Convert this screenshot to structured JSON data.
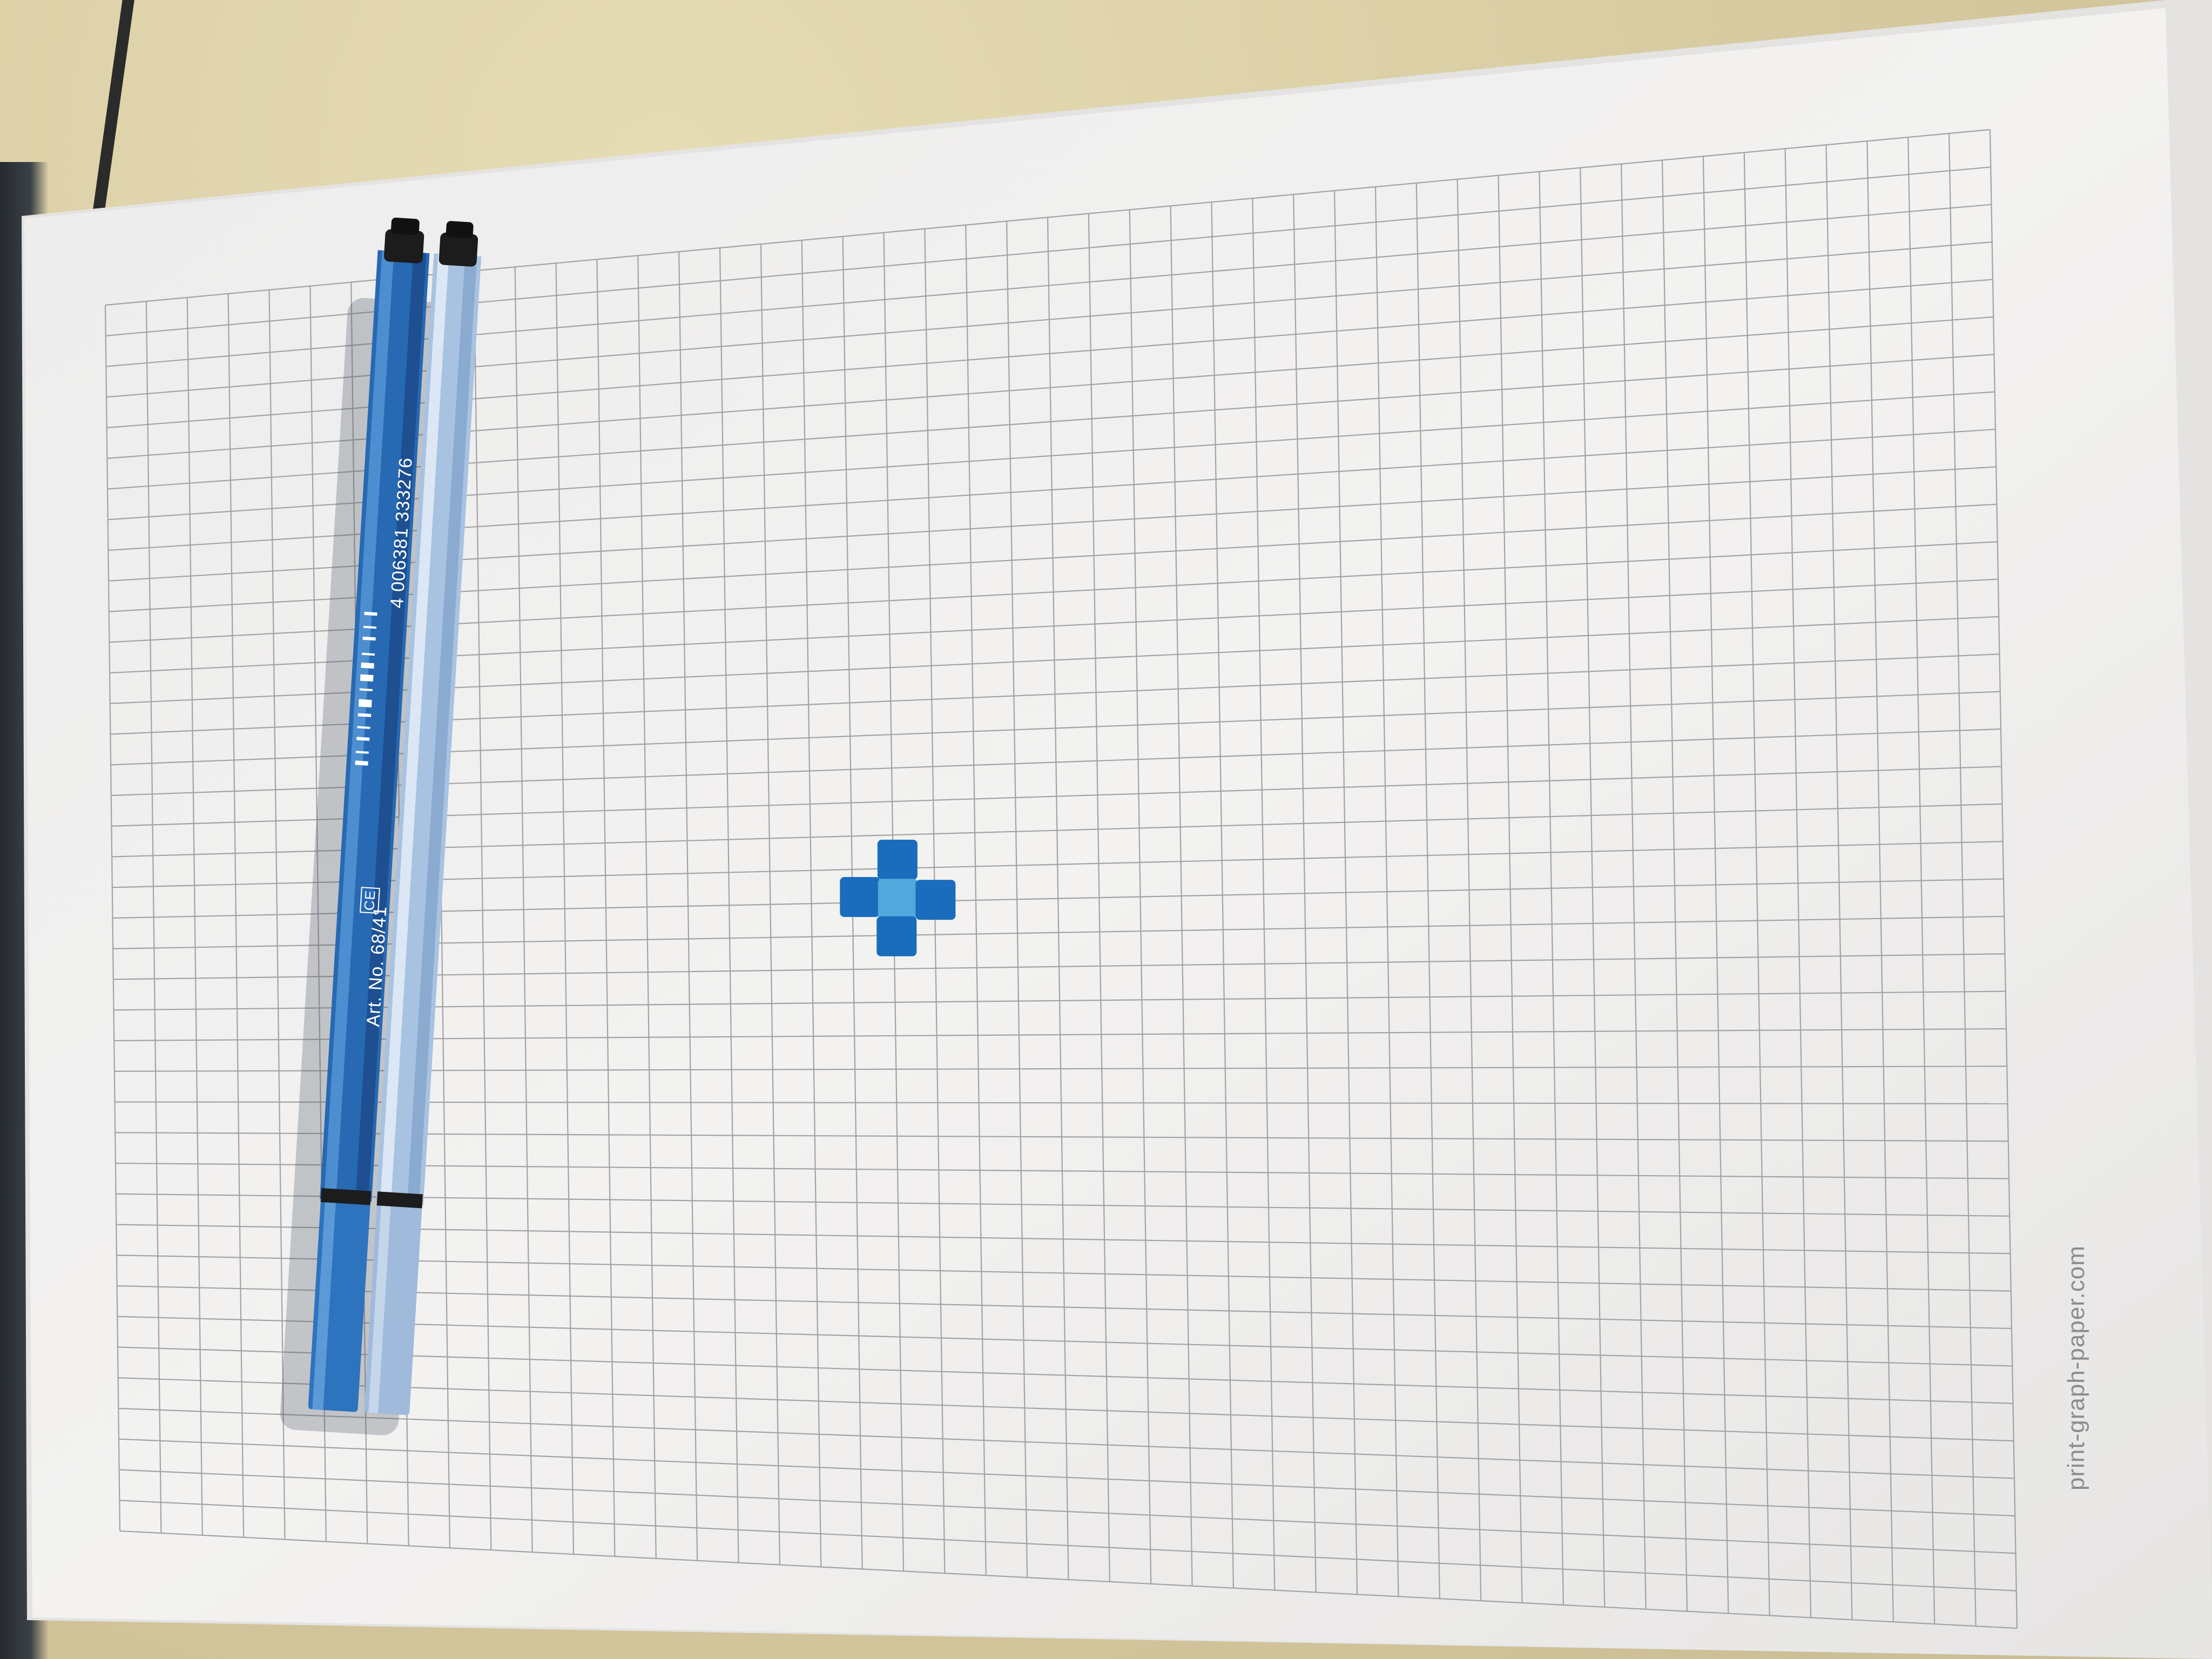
{
  "scene": {
    "description_colors": {
      "desk": "#d6c99f",
      "paper": "#f1f0ef",
      "grid_line": "#9a9a9a",
      "ink_dark": "#1668b8",
      "ink_light": "#4aa3d8",
      "pen_dark_blue": "#2a6db5",
      "pen_light_blue": "#a9c3e0"
    }
  },
  "pen_dark": {
    "article_label": "Art. No. 68/41",
    "barcode_number": "4 006381 333276",
    "ce_mark": "CE"
  },
  "paper": {
    "footer_text": "print-graph-paper.com"
  },
  "drawing": {
    "shape": "plus-cross",
    "cells_filled": 5
  }
}
